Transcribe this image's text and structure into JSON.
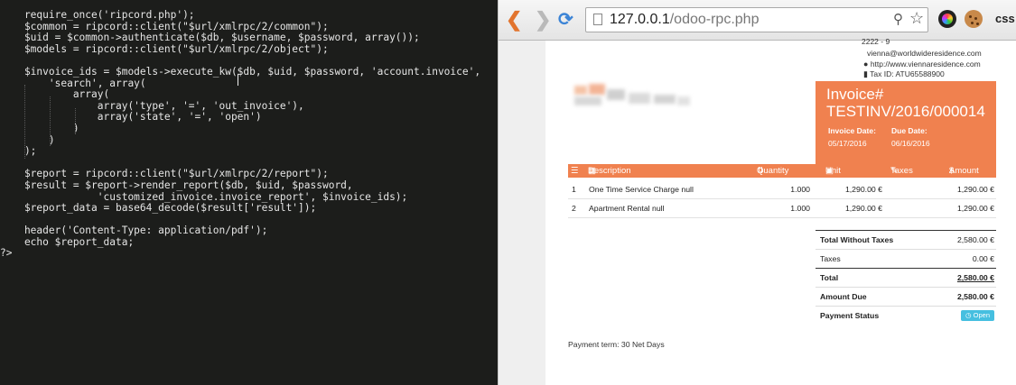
{
  "editor": {
    "code_lines": [
      "    require_once('ripcord.php');",
      "    $common = ripcord::client(\"$url/xmlrpc/2/common\");",
      "    $uid = $common->authenticate($db, $username, $password, array());",
      "    $models = ripcord::client(\"$url/xmlrpc/2/object\");",
      "",
      "    $invoice_ids = $models->execute_kw($db, $uid, $password, 'account.invoice',",
      "        'search', array(",
      "            array(",
      "                array('type', '=', 'out_invoice'),",
      "                array('state', '=', 'open')",
      "            )",
      "        )",
      "    );",
      "",
      "    $report = ripcord::client(\"$url/xmlrpc/2/report\");",
      "    $result = $report->render_report($db, $uid, $password,",
      "                'customized_invoice.invoice_report', $invoice_ids);",
      "    $report_data = base64_decode($result['result']);",
      "",
      "    header('Content-Type: application/pdf');",
      "    echo $report_data;",
      "?>"
    ]
  },
  "browser": {
    "url_host": "127.0.0.1",
    "url_path": "/odoo-rpc.php",
    "extension_label": "css"
  },
  "invoice": {
    "company": {
      "address": "2222 - 9",
      "email": "vienna@worldwideresidence.com",
      "website": "http://www.viennaresidence.com",
      "tax_id": "Tax ID: ATU65588900"
    },
    "title_line1": "Invoice#",
    "title_line2": "TESTINV/2016/000014",
    "invoice_date_label": "Invoice Date:",
    "invoice_date": "05/17/2016",
    "due_date_label": "Due Date:",
    "due_date": "06/16/2016",
    "columns": {
      "description": "Description",
      "quantity": "Quantity",
      "unit_price": "Unit Price",
      "taxes": "Taxes",
      "amount": "Amount"
    },
    "lines": [
      {
        "no": "1",
        "description": "One Time Service Charge null",
        "quantity": "1.000",
        "unit_price": "1,290.00 €",
        "amount": "1,290.00 €"
      },
      {
        "no": "2",
        "description": "Apartment Rental null",
        "quantity": "1.000",
        "unit_price": "1,290.00 €",
        "amount": "1,290.00 €"
      }
    ],
    "totals": {
      "without_taxes_label": "Total Without Taxes",
      "without_taxes": "2,580.00 €",
      "taxes_label": "Taxes",
      "taxes": "0.00 €",
      "total_label": "Total",
      "total": "2,580.00 €",
      "amount_due_label": "Amount Due",
      "amount_due": "2,580.00 €",
      "payment_status_label": "Payment Status",
      "payment_status": "Open"
    },
    "payment_term": "Payment term: 30 Net Days"
  },
  "colors": {
    "accent": "#f0814f",
    "status_badge": "#46bfe0",
    "editor_bg": "#1c1d1b"
  }
}
